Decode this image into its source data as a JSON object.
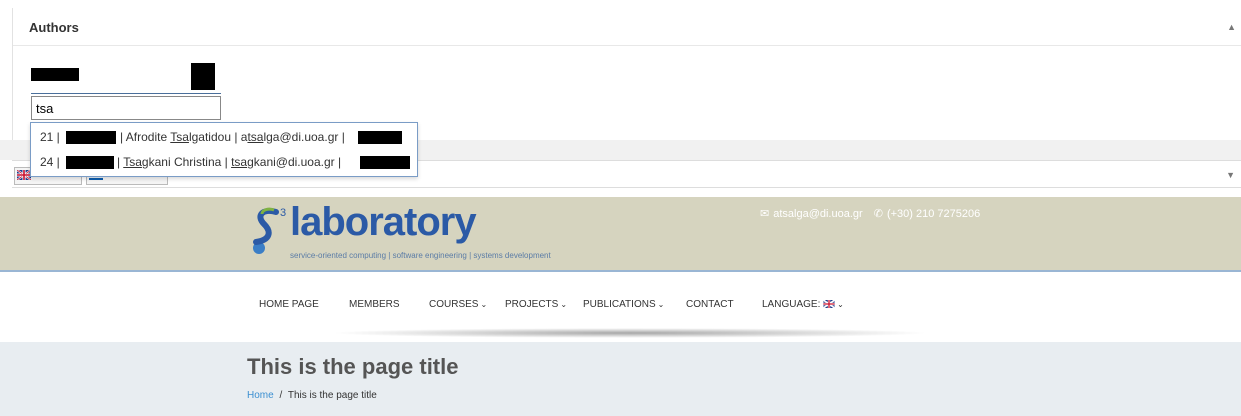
{
  "authors": {
    "title": "Authors",
    "input_value": "tsa"
  },
  "suggestions": [
    {
      "id": "21 |",
      "name_pre": "| Afrodite ",
      "name_match": "Tsa",
      "name_post": "lgatidou | a",
      "email_match": "tsa",
      "email_post": "lga@di.uoa.gr |"
    },
    {
      "id": "24 |",
      "name_pre": "| ",
      "name_match": "Tsa",
      "name_post": "gkani Christina | ",
      "email_match": "tsa",
      "email_post": "gkani@di.uoa.gr |"
    }
  ],
  "header": {
    "logo_word": "laboratory",
    "logo_sup": "3",
    "logo_tagline": "service-oriented computing | software engineering | systems development",
    "email": "atsalga@di.uoa.gr",
    "phone": "(+30) 210 7275206"
  },
  "nav": {
    "home": "HOME PAGE",
    "members": "MEMBERS",
    "courses": "COURSES",
    "projects": "PROJECTS",
    "publications": "PUBLICATIONS",
    "contact": "CONTACT",
    "language": "LANGUAGE:"
  },
  "page": {
    "title": "This is the page title",
    "breadcrumb_home": "Home",
    "breadcrumb_sep": "/",
    "breadcrumb_current": "This is the page title"
  },
  "icons": [
    "chevron-up-icon",
    "chevron-down-icon",
    "uk-flag-icon",
    "greek-flag-icon",
    "envelope-icon",
    "phone-icon"
  ],
  "colors": {
    "accent": "#3b8fd1",
    "header_bg": "#d6d4bf",
    "logo_blue": "#2b5aa6",
    "title_bg": "#e8edf1"
  }
}
